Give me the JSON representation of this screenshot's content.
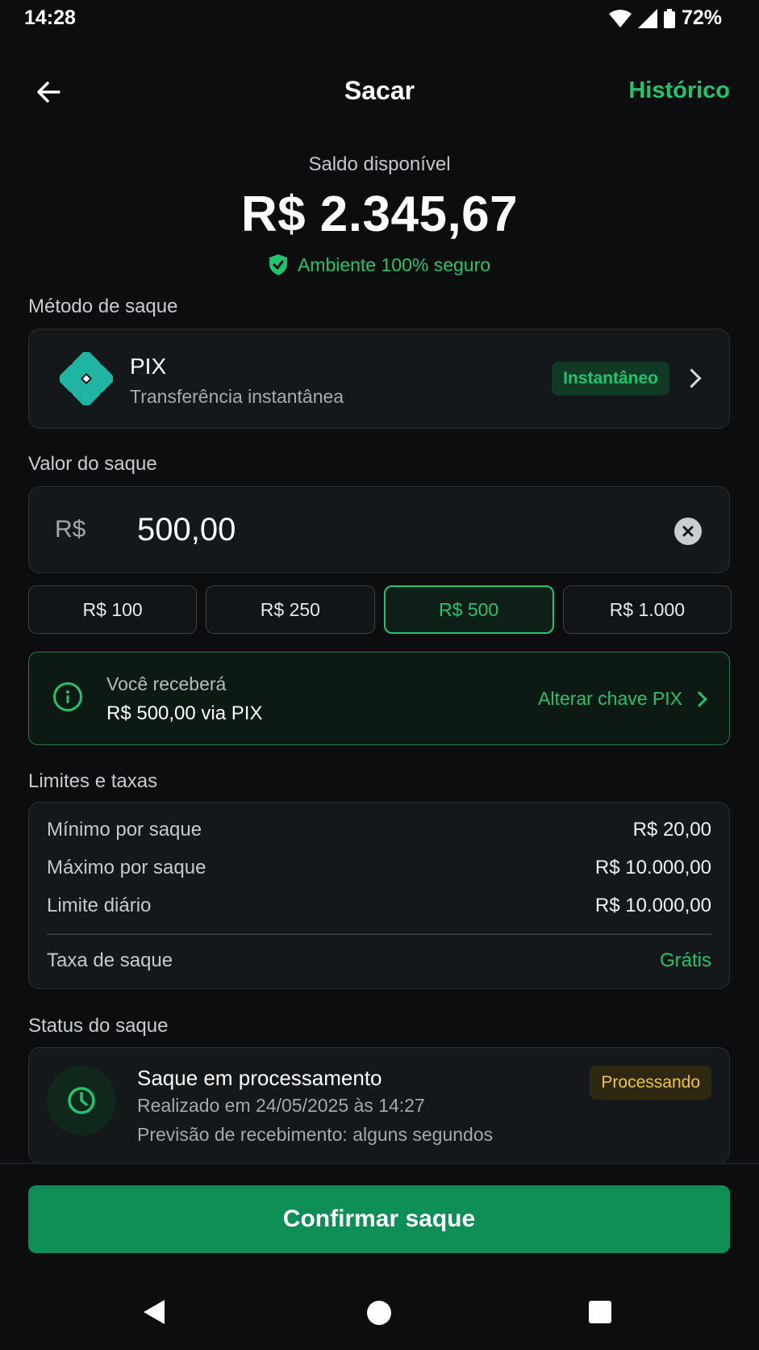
{
  "status_bar": {
    "time": "14:28",
    "battery": "72%"
  },
  "header": {
    "title": "Sacar",
    "history_link": "Histórico"
  },
  "balance": {
    "label": "Saldo disponível",
    "value": "R$ 2.345,67",
    "secure_text": "Ambiente 100% seguro"
  },
  "method": {
    "section_label": "Método de saque",
    "name": "PIX",
    "description": "Transferência instantânea",
    "badge": "Instantâneo"
  },
  "amount": {
    "section_label": "Valor do saque",
    "currency": "R$",
    "value": "500,00",
    "quick_options": [
      "R$ 100",
      "R$ 250",
      "R$ 500",
      "R$ 1.000"
    ],
    "selected_option": "R$ 500"
  },
  "receive": {
    "label": "Você receberá",
    "value": "R$ 500,00 via PIX",
    "change_link": "Alterar chave PIX"
  },
  "limits": {
    "section_label": "Limites e taxas",
    "rows": [
      {
        "label": "Mínimo por saque",
        "value": "R$ 20,00"
      },
      {
        "label": "Máximo por saque",
        "value": "R$ 10.000,00"
      },
      {
        "label": "Limite diário",
        "value": "R$ 10.000,00"
      }
    ],
    "fee_label": "Taxa de saque",
    "fee_value": "Grátis"
  },
  "withdraw_status": {
    "section_label": "Status do saque",
    "title": "Saque em processamento",
    "badge": "Processando",
    "line1": "Realizado em 24/05/2025 às 14:27",
    "line2": "Previsão de recebimento: alguns segundos"
  },
  "confirm_button": "Confirmar saque",
  "colors": {
    "accent": "#22c36e",
    "button": "#0e8f55",
    "warning": "#f0c43a",
    "background": "#0b0d0f"
  }
}
